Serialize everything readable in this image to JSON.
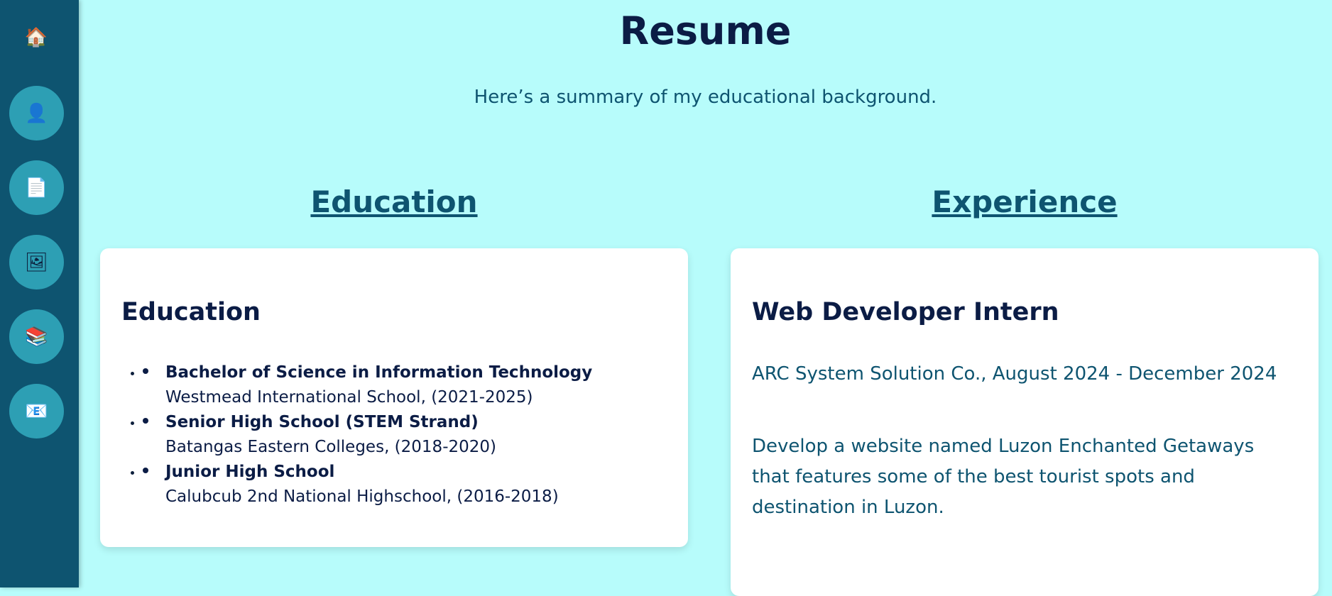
{
  "sidebar": {
    "items": [
      {
        "name": "home",
        "icon": "home-icon",
        "glyph": "🏠"
      },
      {
        "name": "about",
        "icon": "person-icon",
        "glyph": "👤"
      },
      {
        "name": "resume",
        "icon": "document-icon",
        "glyph": "📄"
      },
      {
        "name": "portfolio",
        "icon": "picture-icon",
        "glyph": "🖼"
      },
      {
        "name": "services",
        "icon": "books-icon",
        "glyph": "📚"
      },
      {
        "name": "contact",
        "icon": "envelope-icon",
        "glyph": "📧"
      }
    ]
  },
  "page": {
    "title": "Resume",
    "subtitle": "Here’s a summary of my educational background."
  },
  "education": {
    "heading": "Education",
    "card_title": "Education",
    "items": [
      {
        "degree": "Bachelor of Science in Information Technology",
        "school": "Westmead International School, (2021-2025)"
      },
      {
        "degree": "Senior High School (STEM Strand)",
        "school": "Batangas Eastern Colleges, (2018-2020)"
      },
      {
        "degree": "Junior High School",
        "school": "Calubcub 2nd National Highschool, (2016-2018)"
      }
    ]
  },
  "experience": {
    "heading": "Experience",
    "card_title": "Web Developer Intern",
    "company": "ARC System Solution Co., August 2024 - December 2024",
    "description": "Develop a website named Luzon Enchanted Getaways that features some of the best tourist spots and destination in Luzon."
  },
  "colors": {
    "background": "#b7fcfb",
    "sidebar": "#0e5470",
    "nav_circle": "#2d9fb4",
    "title": "#0b1c45",
    "accent": "#0e5470"
  }
}
